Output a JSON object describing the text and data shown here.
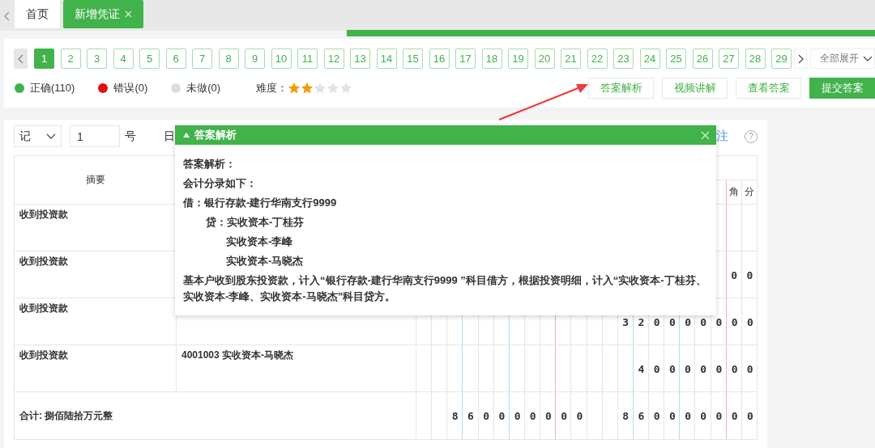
{
  "tabs": [
    {
      "label": "首页",
      "selected": false,
      "closable": false
    },
    {
      "label": "新增凭证",
      "selected": true,
      "closable": true
    }
  ],
  "pager": {
    "pages": [
      {
        "label": "1",
        "selected": true
      },
      {
        "label": "2",
        "selected": false
      },
      {
        "label": "3",
        "selected": false
      },
      {
        "label": "4",
        "selected": false
      },
      {
        "label": "5",
        "selected": false
      },
      {
        "label": "6",
        "selected": false
      },
      {
        "label": "7",
        "selected": false
      },
      {
        "label": "8",
        "selected": false
      },
      {
        "label": "9",
        "selected": false
      },
      {
        "label": "10",
        "selected": false
      },
      {
        "label": "11",
        "selected": false
      },
      {
        "label": "12",
        "selected": false
      },
      {
        "label": "13",
        "selected": false
      },
      {
        "label": "14",
        "selected": false
      },
      {
        "label": "15",
        "selected": false
      },
      {
        "label": "16",
        "selected": false
      },
      {
        "label": "17",
        "selected": false
      },
      {
        "label": "18",
        "selected": false
      },
      {
        "label": "19",
        "selected": false
      },
      {
        "label": "20",
        "selected": false
      },
      {
        "label": "21",
        "selected": false
      },
      {
        "label": "22",
        "selected": false
      },
      {
        "label": "23",
        "selected": false
      },
      {
        "label": "24",
        "selected": false
      },
      {
        "label": "25",
        "selected": false
      },
      {
        "label": "26",
        "selected": false
      },
      {
        "label": "27",
        "selected": false
      },
      {
        "label": "28",
        "selected": false
      },
      {
        "label": "29",
        "selected": false
      }
    ],
    "expand_dropdown": "全部展开"
  },
  "legend": [
    {
      "label": "正确(110)",
      "color": "#3fb34b"
    },
    {
      "label": "错误(0)",
      "color": "#dd1111"
    },
    {
      "label": "未做(0)",
      "color": "#dddddd"
    }
  ],
  "difficulty": {
    "label": "难度：",
    "stars": 2
  },
  "actions": [
    {
      "label": "答案解析",
      "kind": "outline"
    },
    {
      "label": "视频讲解",
      "kind": "outline"
    },
    {
      "label": "查看答案",
      "kind": "outline"
    },
    {
      "label": "提交答案",
      "kind": "primary"
    }
  ],
  "voucher": {
    "type_select": "记",
    "number": "1",
    "number_suffix": "号",
    "date_label": "日",
    "remark_link": "注",
    "help": "?"
  },
  "table": {
    "header": {
      "summary": "摘要",
      "credit_units": [
        "角",
        "分"
      ]
    },
    "rows": [
      {
        "summary": "收到投资款"
      },
      {
        "summary": "收到投资款",
        "credit": "0 0"
      },
      {
        "summary": "收到投资款",
        "credit": "3 2 0 0 0 0 0 0 0"
      },
      {
        "summary": "收到投资款",
        "account": "4001003 实收资本-马晓杰",
        "credit": "4 0 0 0 0 0 0 0"
      }
    ],
    "total": {
      "label": "合计: 捌佰陆拾万元整",
      "debit": "8 6 0 0 0 0 0 0 0",
      "credit": "8 6 0 0 0 0 0 0 0"
    }
  },
  "answer_popup": {
    "title": "答案解析",
    "lines": [
      {
        "kind": "line",
        "text": "答案解析："
      },
      {
        "kind": "line",
        "text": "会计分录如下："
      },
      {
        "kind": "line",
        "text": "借：银行存款-建行华南支行9999"
      },
      {
        "kind": "credit",
        "text": "贷：实收资本-丁桂芬"
      },
      {
        "kind": "credit_more",
        "text": "实收资本-李峰"
      },
      {
        "kind": "credit_more",
        "text": "实收资本-马晓杰"
      },
      {
        "kind": "paragraph",
        "text": "基本户收到股东投资款，计入“银行存款-建行华南支行9999 ”科目借方，根据投资明细，计入“实收资本-丁桂芬、实收资本-李峰、实收资本-马晓杰”科目贷方。"
      }
    ]
  }
}
